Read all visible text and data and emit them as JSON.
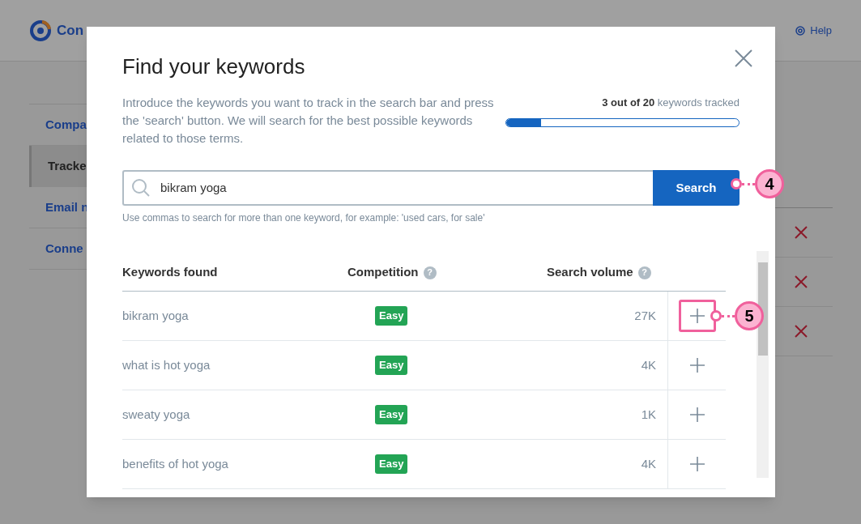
{
  "header": {
    "logo_text": "Con",
    "help": "Help"
  },
  "sidebar": {
    "items": [
      {
        "label": "Compa",
        "selected": false
      },
      {
        "label": "Tracke",
        "selected": true
      },
      {
        "label": "Email n",
        "selected": false
      },
      {
        "label": "Conne",
        "selected": false
      }
    ]
  },
  "modal": {
    "title": "Find your keywords",
    "description": "Introduce the keywords you want to track in the search bar and press the 'search' button. We will search for the best possible keywords related to those terms.",
    "tracked": "**3 out of 20** keywords tracked",
    "level": 0.15,
    "search": {
      "value": "bikram yoga",
      "button": "Search",
      "hint": "Use commas to search for more than one keyword, for example: 'used cars, for sale'"
    },
    "table": {
      "columns": [
        "Keywords found",
        "Competition",
        "Search volume"
      ],
      "help_marks": [
        "?",
        "?"
      ],
      "rows": [
        {
          "keyword": "bikram yoga",
          "competition": "Easy",
          "volume": "27K",
          "highlighted": true
        },
        {
          "keyword": "what is hot yoga",
          "competition": "Easy",
          "volume": "4K",
          "highlighted": false
        },
        {
          "keyword": "sweaty yoga",
          "competition": "Easy",
          "volume": "1K",
          "highlighted": false
        },
        {
          "keyword": "benefits of hot yoga",
          "competition": "Easy",
          "volume": "4K",
          "highlighted": false
        }
      ]
    }
  },
  "callouts": [
    {
      "number": "4"
    },
    {
      "number": "5"
    }
  ]
}
